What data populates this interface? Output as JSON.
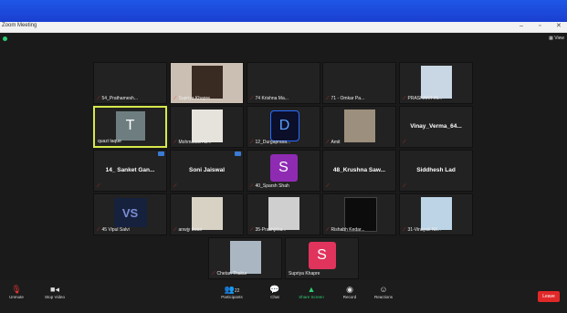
{
  "window": {
    "title": "Zoom Meeting",
    "view_label": "View"
  },
  "tiles": [
    {
      "name": "54_Prathamesh..."
    },
    {
      "name": "Supriya Khapre"
    },
    {
      "name": "74 Krishna Ma..."
    },
    {
      "name": "71 - Omkar Pa..."
    },
    {
      "name": "PRASHANT IN..."
    },
    {
      "name": "quazi taque",
      "avatar": "T",
      "avatar_bg": "#6e7d80"
    },
    {
      "name": "Mohmadali Ab..."
    },
    {
      "name": "12_Durgaprasa...",
      "avatar": "D"
    },
    {
      "name": "Amit"
    },
    {
      "name": "Vinay_Verma_64...",
      "bigname": "Vinay_Verma_64..."
    },
    {
      "bigname": "14_ Sanket Gan..."
    },
    {
      "bigname": "Soni Jaiswal"
    },
    {
      "name": "40_Sparsh Shah",
      "avatar": "S",
      "avatar_bg": "#8f2bb3"
    },
    {
      "bigname": "48_Krushna Saw..."
    },
    {
      "bigname": "Siddhesh Lad"
    },
    {
      "name": "45 Vipul Salvi",
      "avatar": "VS"
    },
    {
      "name": "anwjy tiwari"
    },
    {
      "name": "35-Prabhjitha..."
    },
    {
      "name": "Rishabh Kedar..."
    },
    {
      "name": "31-Vinayak Nil..."
    },
    {
      "name": "Chetan Thakur"
    },
    {
      "name": "Supriya Khapre",
      "avatar": "S",
      "avatar_bg": "#e0345c"
    }
  ],
  "toolbar": {
    "unmute": "Unmute",
    "stop_video": "Stop Video",
    "participants": "Participants",
    "participants_count": "22",
    "chat": "Chat",
    "share_screen": "Share Screen",
    "record": "Record",
    "reactions": "Reactions",
    "leave": "Leave"
  }
}
